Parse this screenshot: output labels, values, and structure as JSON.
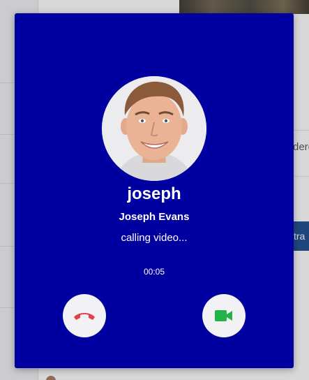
{
  "background": {
    "partial_text": "dere",
    "partial_button": "tra"
  },
  "call": {
    "username": "joseph",
    "full_name": "Joseph Evans",
    "status": "calling video...",
    "timer": "00:05",
    "decline_icon": "phone-hangup-icon",
    "accept_icon": "video-camera-icon"
  },
  "colors": {
    "modal_background": "#0000a0",
    "decline": "#e0424c",
    "accept": "#24b24a"
  }
}
